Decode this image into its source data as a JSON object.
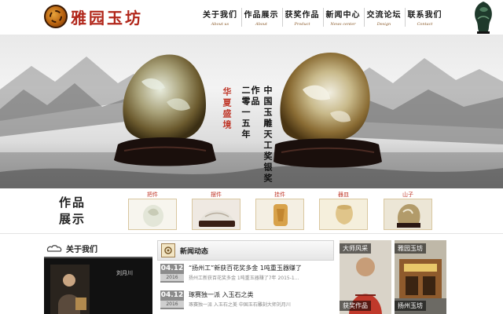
{
  "header": {
    "logo_text": "雅园玉坊",
    "nav": [
      {
        "cn": "关于我们",
        "en": "About us"
      },
      {
        "cn": "作品展示",
        "en": "About"
      },
      {
        "cn": "获奖作品",
        "en": "Product"
      },
      {
        "cn": "新闻中心",
        "en": "News center"
      },
      {
        "cn": "交流论坛",
        "en": "Design"
      },
      {
        "cn": "联系我们",
        "en": "Contact"
      }
    ]
  },
  "banner": {
    "red_text": "华夏盛境",
    "text_right": "二零一五年",
    "text_left": "中国玉雕天工奖银奖作品",
    "slides": 8,
    "active_slide": 7
  },
  "works": {
    "title": "作品展示",
    "items": [
      {
        "label": "把件"
      },
      {
        "label": "摆件"
      },
      {
        "label": "挂件"
      },
      {
        "label": "器皿"
      },
      {
        "label": "山子"
      }
    ]
  },
  "about": {
    "title": "关于我们",
    "name": "刘月川"
  },
  "news": {
    "title": "新闻动态",
    "items": [
      {
        "md": "04.12",
        "year": "2016",
        "title": "“扬州工”新获百花奖多金  1吨重玉器赚了",
        "desc": "扬州工新获百花奖多金  1吨重玉器赚了7年  2015-1..."
      },
      {
        "md": "04.12",
        "year": "2016",
        "title": "琢赛独一派  入玉石之类",
        "desc": "琢赛独一派  入玉石之美  中国玉石雕刻大师刘月川"
      }
    ]
  },
  "tiles": [
    {
      "label": "大师风采"
    },
    {
      "label": "雅园玉坊"
    },
    {
      "label": "获奖作品"
    },
    {
      "label": "扬州玉坊"
    }
  ],
  "colors": {
    "accent": "#b1261a",
    "news_date": "#8c8c8c"
  }
}
